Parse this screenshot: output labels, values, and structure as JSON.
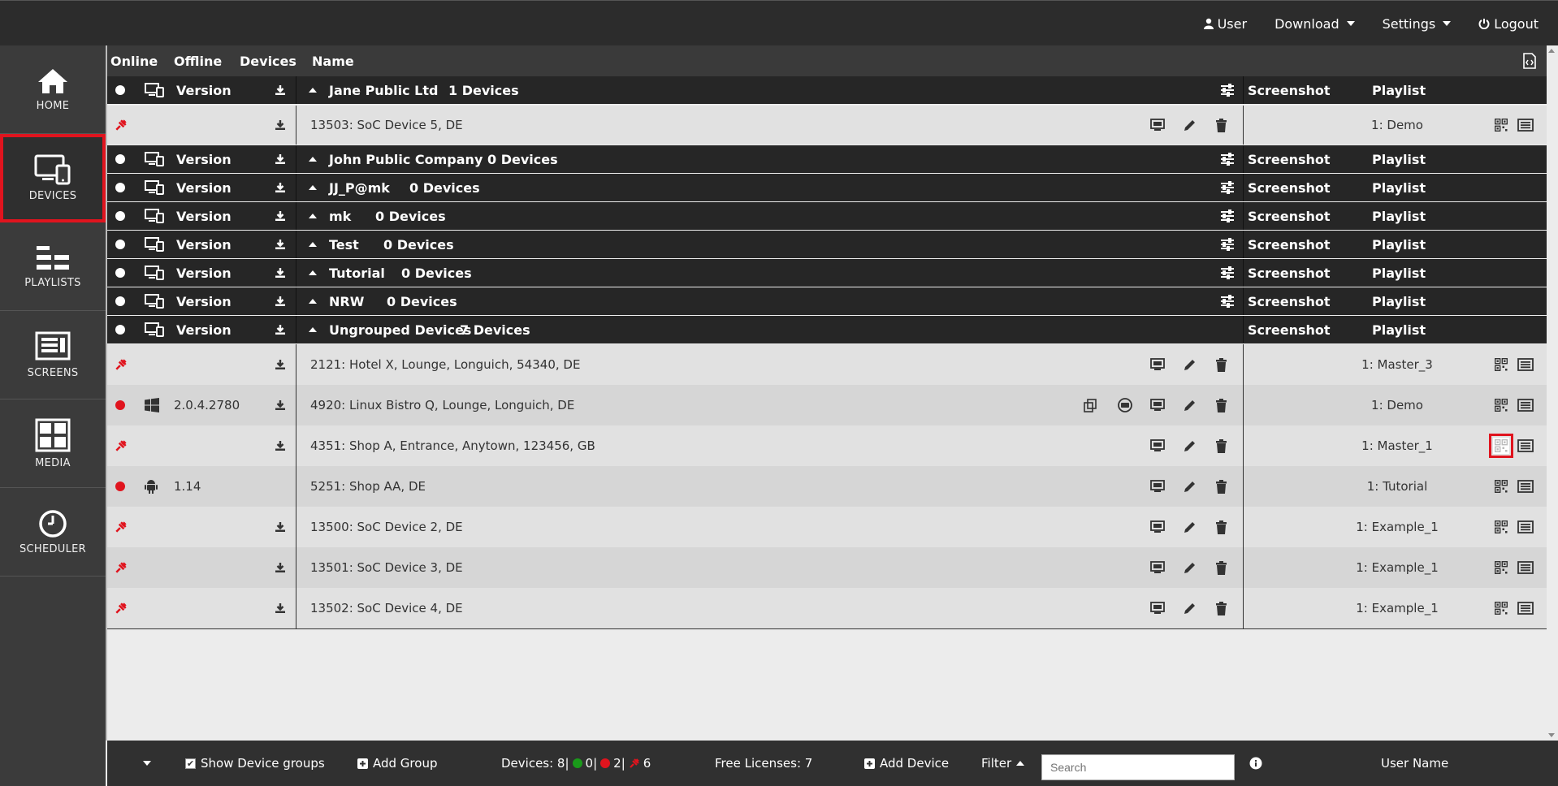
{
  "topnav": {
    "user": "User",
    "download": "Download",
    "settings": "Settings",
    "logout": "Logout"
  },
  "sidebar": {
    "items": [
      {
        "label": "HOME",
        "icon": "home-icon"
      },
      {
        "label": "DEVICES",
        "icon": "devices-icon",
        "active": true
      },
      {
        "label": "PLAYLISTS",
        "icon": "playlists-icon"
      },
      {
        "label": "SCREENS",
        "icon": "screens-icon"
      },
      {
        "label": "MEDIA",
        "icon": "media-icon"
      },
      {
        "label": "SCHEDULER",
        "icon": "clock-icon"
      }
    ]
  },
  "columns": {
    "online": "Online",
    "offline": "Offline",
    "devices": "Devices",
    "name": "Name"
  },
  "groups": [
    {
      "header": {
        "version": "Version",
        "name": "Jane Public Ltd",
        "count": "1 Devices",
        "screenshot": "Screenshot",
        "playlist": "Playlist"
      },
      "devices": [
        {
          "name": "13503: SoC Device 5, DE",
          "playlist": "1: Demo"
        }
      ]
    },
    {
      "header": {
        "version": "Version",
        "name": "John Public Company",
        "count": "0 Devices",
        "screenshot": "Screenshot",
        "playlist": "Playlist"
      }
    },
    {
      "header": {
        "version": "Version",
        "name": "JJ_P@mk",
        "count": "0 Devices",
        "screenshot": "Screenshot",
        "playlist": "Playlist"
      }
    },
    {
      "header": {
        "version": "Version",
        "name": "mk",
        "count": "0 Devices",
        "screenshot": "Screenshot",
        "playlist": "Playlist"
      }
    },
    {
      "header": {
        "version": "Version",
        "name": "Test",
        "count": "0 Devices",
        "screenshot": "Screenshot",
        "playlist": "Playlist"
      }
    },
    {
      "header": {
        "version": "Version",
        "name": "Tutorial",
        "count": "0 Devices",
        "screenshot": "Screenshot",
        "playlist": "Playlist"
      }
    },
    {
      "header": {
        "version": "Version",
        "name": "NRW",
        "count": "0 Devices",
        "screenshot": "Screenshot",
        "playlist": "Playlist"
      }
    },
    {
      "header": {
        "version": "Version",
        "name": "Ungrouped Devices",
        "count": "7 Devices",
        "screenshot": "Screenshot",
        "playlist": "Playlist"
      },
      "devices": [
        {
          "name": "2121: Hotel X, Lounge, Longuich, 54340, DE",
          "playlist": "1: Master_3"
        },
        {
          "name": "4920: Linux Bistro Q, Lounge, Longuich, DE",
          "version": "2.0.4.2780",
          "playlist": "1: Demo"
        },
        {
          "name": "4351: Shop A, Entrance, Anytown, 123456, GB",
          "playlist": "1: Master_1"
        },
        {
          "name": "5251: Shop AA, DE",
          "version": "1.14",
          "playlist": "1: Tutorial"
        },
        {
          "name": "13500: SoC Device 2, DE",
          "playlist": "1: Example_1"
        },
        {
          "name": "13501: SoC Device 3, DE",
          "playlist": "1: Example_1"
        },
        {
          "name": "13502: SoC Device 4, DE",
          "playlist": "1: Example_1"
        }
      ]
    }
  ],
  "footer": {
    "show_groups": "Show Device groups",
    "add_group": "Add Group",
    "devices_label": "Devices: 8|",
    "online_count": "0|",
    "offline_count": "2|",
    "disconnected_count": "6",
    "free_licenses": "Free Licenses: 7",
    "add_device": "Add Device",
    "filter": "Filter",
    "search_placeholder": "Search",
    "user_name": "User Name"
  },
  "colors": {
    "accent_red": "#e0141e",
    "online_green": "#1a9a1a",
    "topbar": "#2c2c2c",
    "sidebar": "#3b3b3b",
    "group_row": "#262626"
  }
}
